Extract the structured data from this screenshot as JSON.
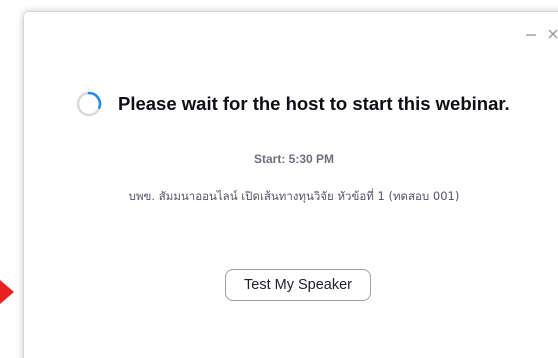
{
  "window": {
    "controls": {
      "minimize_icon": "minimize-icon",
      "close_icon": "close-icon"
    }
  },
  "waiting": {
    "spinner_icon": "loading-spinner-icon",
    "title": "Please wait for the host to start this webinar."
  },
  "schedule": {
    "start": "Start: 5:30 PM"
  },
  "webinar": {
    "topic": "บพข. สัมมนาออนไลน์ เปิดเส้นทางทุนวิจัย หัวข้อที่ 1 (ทดสอบ 001)"
  },
  "actions": {
    "test_speaker_label": "Test My Speaker"
  },
  "colors": {
    "spinner_accent": "#1f8ceb",
    "spinner_track": "#d8d8de",
    "arrow": "#e8201f"
  }
}
